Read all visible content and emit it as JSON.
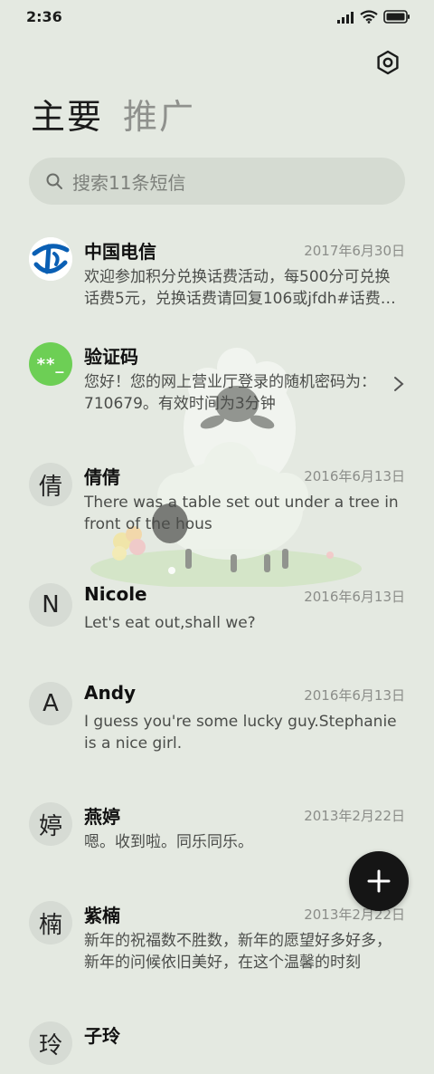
{
  "status_bar": {
    "time": "2:36"
  },
  "tabs": [
    {
      "label": "主要",
      "active": true
    },
    {
      "label": "推广",
      "active": false
    }
  ],
  "search": {
    "placeholder": "搜索11条短信"
  },
  "conversations": [
    {
      "sender": "中国电信",
      "date": "2017年6月30日",
      "snippet": "欢迎参加积分兑换话费活动，每500分可兑换话费5元，兑换话费请回复106或jfdh#话费…",
      "avatar_type": "china-telecom-logo"
    },
    {
      "sender": "验证码",
      "date": "",
      "snippet": "您好！您的网上营业厅登录的随机密码为：710679。有效时间为3分钟",
      "avatar_type": "code",
      "avatar_text": "**_"
    },
    {
      "sender": "倩倩",
      "date": "2016年6月13日",
      "snippet": "There was a table set out under a tree in front of the hous",
      "avatar_text": "倩"
    },
    {
      "sender": "Nicole",
      "date": "2016年6月13日",
      "snippet": "Let's eat out,shall we?",
      "avatar_text": "N"
    },
    {
      "sender": "Andy",
      "date": "2016年6月13日",
      "snippet": "I guess you're some lucky guy.Stephanie is a nice girl.",
      "avatar_text": "A"
    },
    {
      "sender": "燕婷",
      "date": "2013年2月22日",
      "snippet": "嗯。收到啦。同乐同乐。",
      "avatar_text": "婷"
    },
    {
      "sender": "紫楠",
      "date": "2013年2月22日",
      "snippet": "新年的祝福数不胜数，新年的愿望好多好多，新年的问候依旧美好，在这个温馨的时刻",
      "avatar_text": "楠"
    },
    {
      "sender": "子玲",
      "date": "",
      "snippet": "",
      "avatar_text": "玲"
    }
  ],
  "colors": {
    "background": "#e4e9e1",
    "search_bg": "#d5dbd2",
    "code_avatar": "#6dcf55",
    "telecom_blue": "#0a5fb4",
    "fab": "#151515"
  }
}
